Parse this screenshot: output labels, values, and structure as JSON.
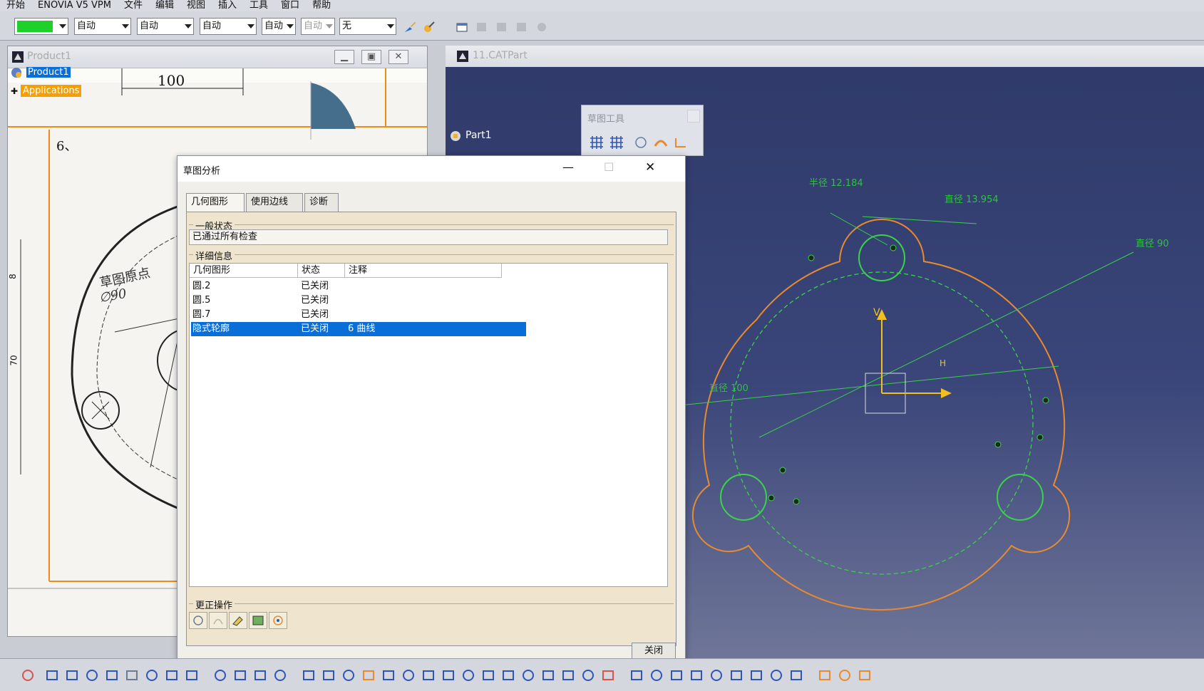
{
  "menu": [
    "开始",
    "ENOVIA V5 VPM",
    "文件",
    "编辑",
    "视图",
    "插入",
    "工具",
    "窗口",
    "帮助"
  ],
  "toolbar": {
    "color_value": "#1fcf2a",
    "combos": [
      "自动",
      "自动",
      "自动",
      "自动",
      "自动",
      "无"
    ]
  },
  "product_window": {
    "title": "Product1",
    "tree_root": "Product1",
    "tree_child": "Applications",
    "drawing": {
      "dim_top": "100",
      "problem_no": "6、",
      "label_text": "草图原点",
      "dia_text": "∅90",
      "vdim_1": "8",
      "vdim_2": "70"
    }
  },
  "part_window": {
    "title": "11.CATPart",
    "tree_item": "Part1",
    "sketch_tools_title": "草图工具",
    "annotations": {
      "radius": "半径 12.184",
      "dia_small": "直径 13.954",
      "dia_90": "直径 90",
      "dia_100": "直径 100",
      "axis_v": "V",
      "axis_h": "H"
    }
  },
  "dialog": {
    "title": "草图分析",
    "tabs": [
      "几何图形",
      "使用边线",
      "诊断"
    ],
    "general_state_label": "一般状态",
    "general_state_value": "已通过所有检查",
    "detail_label": "详细信息",
    "columns": [
      "几何图形",
      "状态",
      "注释"
    ],
    "rows": [
      {
        "geometry": "圆.2",
        "state": "已关闭",
        "note": ""
      },
      {
        "geometry": "圆.5",
        "state": "已关闭",
        "note": ""
      },
      {
        "geometry": "圆.7",
        "state": "已关闭",
        "note": ""
      },
      {
        "geometry": "隐式轮廓",
        "state": "已关闭",
        "note": "6 曲线"
      }
    ],
    "selected_row": 3,
    "fix_label": "更正操作",
    "close_label": "关闭"
  },
  "colors": {
    "selection": "#0a6ed8",
    "sketch_orange": "#e98a2e",
    "sketch_green": "#39d24a",
    "axis_yellow": "#f0c020"
  }
}
